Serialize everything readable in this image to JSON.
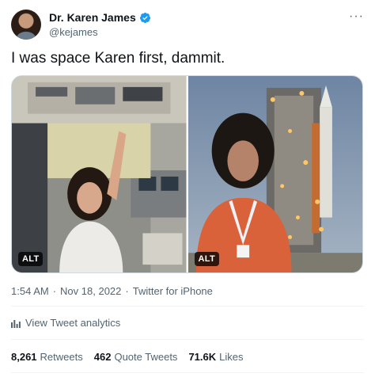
{
  "tweet": {
    "author": {
      "display_name": "Dr. Karen James",
      "handle": "@kejames",
      "verified_icon": "verified-badge-icon",
      "badge_color": "#1d9bf0"
    },
    "more_label": "···",
    "text": "I was space Karen first, dammit.",
    "media": [
      {
        "alt_label": "ALT"
      },
      {
        "alt_label": "ALT"
      }
    ],
    "meta": {
      "time": "1:54 AM",
      "separator1": "·",
      "date": "Nov 18, 2022",
      "separator2": "·",
      "source": "Twitter for iPhone"
    },
    "analytics_label": "View Tweet analytics",
    "stats": [
      {
        "count": "8,261",
        "label": "Retweets"
      },
      {
        "count": "462",
        "label": "Quote Tweets"
      },
      {
        "count": "71.6K",
        "label": "Likes"
      }
    ]
  }
}
